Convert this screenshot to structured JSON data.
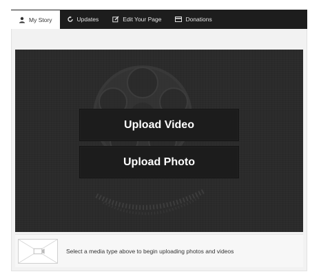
{
  "tabs": [
    {
      "label": "My Story",
      "icon": "user-icon",
      "active": true
    },
    {
      "label": "Updates",
      "icon": "refresh-icon",
      "active": false
    },
    {
      "label": "Edit Your Page",
      "icon": "edit-icon",
      "active": false
    },
    {
      "label": "Donations",
      "icon": "card-icon",
      "active": false
    }
  ],
  "upload": {
    "video_label": "Upload Video",
    "photo_label": "Upload Photo"
  },
  "info": {
    "message": "Select a media type above to begin uploading photos and videos",
    "thumbnail_icon": "media-placeholder-icon"
  },
  "colors": {
    "tabbar_bg": "#1d1d1d",
    "stage_bg": "#2b2b2b",
    "button_bg": "#1c1c1c",
    "panel_bg": "#f2f2f2"
  }
}
